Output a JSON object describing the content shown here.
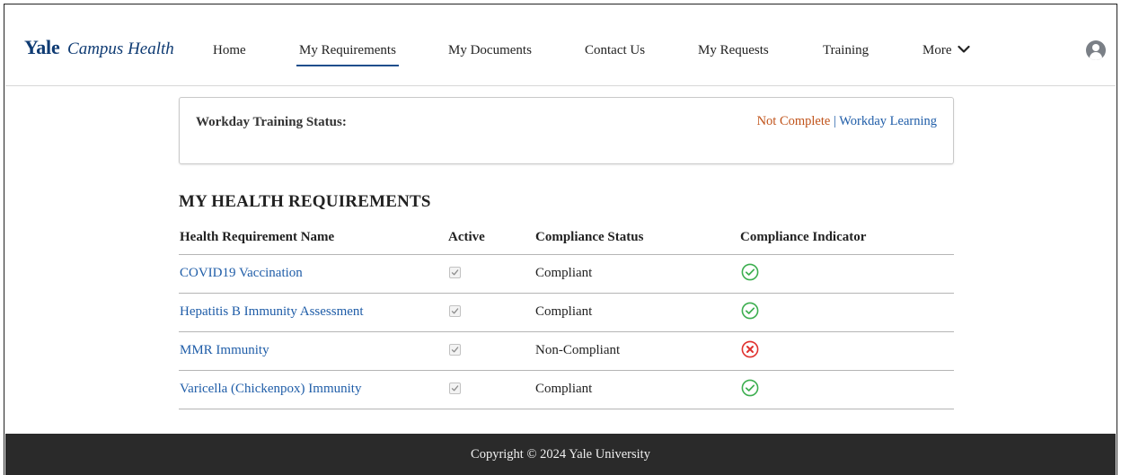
{
  "brand": {
    "name": "Yale",
    "sub": "Campus Health"
  },
  "nav": {
    "items": [
      {
        "label": "Home"
      },
      {
        "label": "My Requirements"
      },
      {
        "label": "My Documents"
      },
      {
        "label": "Contact Us"
      },
      {
        "label": "My Requests"
      },
      {
        "label": "Training"
      },
      {
        "label": "More"
      }
    ],
    "active_index": 1
  },
  "training": {
    "label": "Workday Training Status:",
    "status": "Not Complete",
    "separator": "|",
    "link": "Workday Learning"
  },
  "requirements": {
    "title": "MY HEALTH REQUIREMENTS",
    "columns": [
      "Health Requirement Name",
      "Active",
      "Compliance Status",
      "Compliance Indicator"
    ],
    "rows": [
      {
        "name": "COVID19 Vaccination",
        "active": true,
        "status": "Compliant",
        "indicator": "check-circle-icon"
      },
      {
        "name": "Hepatitis B Immunity Assessment",
        "active": true,
        "status": "Compliant",
        "indicator": "check-circle-icon"
      },
      {
        "name": "MMR Immunity",
        "active": true,
        "status": "Non-Compliant",
        "indicator": "x-circle-icon"
      },
      {
        "name": "Varicella (Chickenpox) Immunity",
        "active": true,
        "status": "Compliant",
        "indicator": "check-circle-icon"
      }
    ]
  },
  "footer": {
    "text": "Copyright © 2024 Yale University"
  },
  "colors": {
    "brand": "#0f3b73",
    "link": "#1f5da8",
    "warning": "#c0531a",
    "compliant": "#3cae4f",
    "noncompliant": "#e0312e",
    "footer_bg": "#2a2a2a"
  }
}
